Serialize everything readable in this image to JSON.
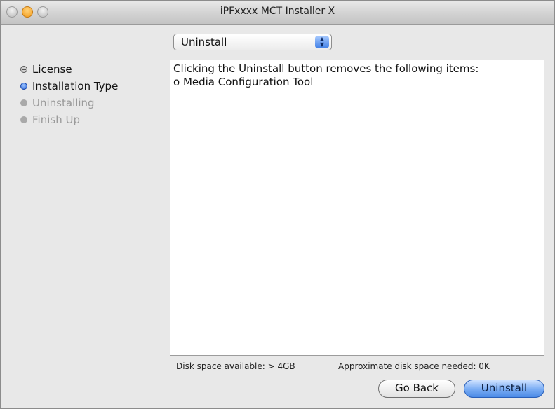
{
  "window": {
    "title": "iPFxxxx  MCT Installer X"
  },
  "steps": [
    {
      "label": "License",
      "state": "done"
    },
    {
      "label": "Installation Type",
      "state": "current"
    },
    {
      "label": "Uninstalling",
      "state": "pending"
    },
    {
      "label": "Finish Up",
      "state": "pending"
    }
  ],
  "mode_select": {
    "selected": "Uninstall"
  },
  "content": {
    "lines": [
      "Clicking the Uninstall button removes the following items:",
      "o Media Configuration Tool"
    ]
  },
  "footer": {
    "disk_available": "Disk space available: > 4GB",
    "disk_needed": "Approximate disk space needed: 0K"
  },
  "buttons": {
    "back": "Go Back",
    "primary": "Uninstall"
  },
  "colors": {
    "accent": "#4b8ae6",
    "minimize": "#f39a18"
  }
}
